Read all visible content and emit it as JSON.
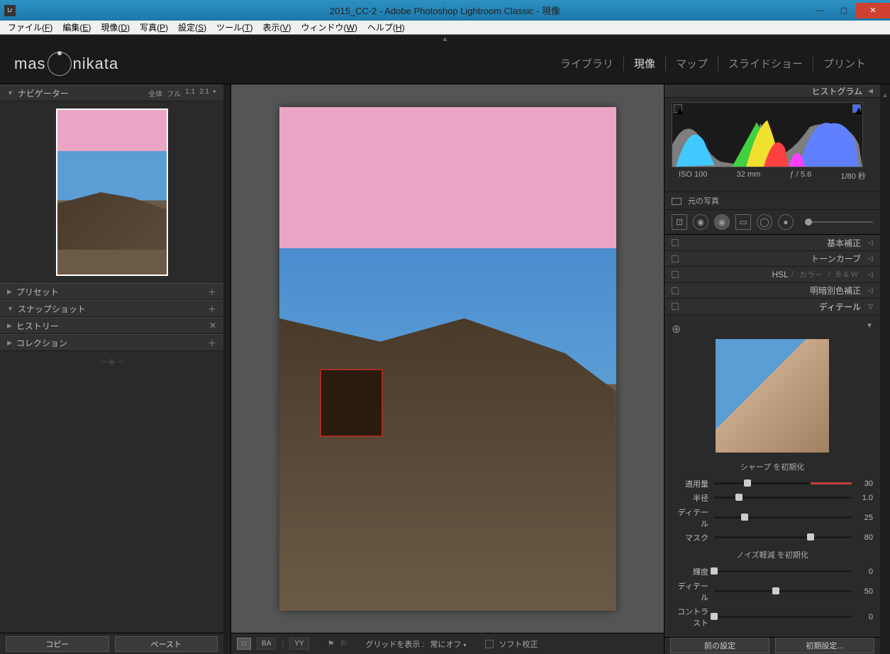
{
  "titlebar": {
    "icon_text": "Lr",
    "title": "2015_CC-2 - Adobe Photoshop Lightroom Classic - 現像"
  },
  "menubar": {
    "items": [
      {
        "label": "ファイル",
        "key": "F"
      },
      {
        "label": "編集",
        "key": "E"
      },
      {
        "label": "現像",
        "key": "D"
      },
      {
        "label": "写真",
        "key": "P"
      },
      {
        "label": "設定",
        "key": "S"
      },
      {
        "label": "ツール",
        "key": "T"
      },
      {
        "label": "表示",
        "key": "V"
      },
      {
        "label": "ウィンドウ",
        "key": "W"
      },
      {
        "label": "ヘルプ",
        "key": "H"
      }
    ]
  },
  "logo_text_pre": "mas",
  "logo_text_post": "nikata",
  "modules": [
    {
      "label": "ライブラリ",
      "active": false
    },
    {
      "label": "現像",
      "active": true
    },
    {
      "label": "マップ",
      "active": false
    },
    {
      "label": "スライドショー",
      "active": false
    },
    {
      "label": "プリント",
      "active": false
    }
  ],
  "left": {
    "navigator": {
      "title": "ナビゲーター",
      "zoom_opts": [
        "全体",
        "フル",
        "1:1",
        "2:1"
      ]
    },
    "presets": {
      "title": "プリセット"
    },
    "snapshots": {
      "title": "スナップショット"
    },
    "history": {
      "title": "ヒストリー"
    },
    "collections": {
      "title": "コレクション"
    },
    "copy_btn": "コピー",
    "paste_btn": "ペースト"
  },
  "center": {
    "grid_label": "グリッドを表示 :",
    "grid_value": "常にオフ",
    "soft_proof": "ソフト校正",
    "view_modes": [
      {
        "label": "□",
        "active": true
      },
      {
        "label": "BA",
        "active": false
      },
      {
        "label": "YY",
        "active": false
      }
    ]
  },
  "right": {
    "histogram_title": "ヒストグラム",
    "exif": {
      "iso": "ISO 100",
      "focal": "32 mm",
      "aperture": "ƒ / 5.6",
      "shutter": "1/80 秒"
    },
    "original": "元の写真",
    "panels": {
      "basic": "基本補正",
      "tone_curve": "トーンカーブ",
      "hsl": "HSL",
      "color": "カラー",
      "bw": "B & W",
      "split_tone": "明暗別色補正",
      "detail": "ディテール"
    },
    "detail": {
      "sharpen_title": "シャープ を初期化",
      "sliders": [
        {
          "label": "適用量",
          "value": "30",
          "pos": 24
        },
        {
          "label": "半径",
          "value": "1.0",
          "pos": 18
        },
        {
          "label": "ディテール",
          "value": "25",
          "pos": 22
        },
        {
          "label": "マスク",
          "value": "80",
          "pos": 70
        }
      ],
      "noise_title": "ノイズ軽減 を初期化",
      "noise_sliders": [
        {
          "label": "輝度",
          "value": "0",
          "pos": 0
        },
        {
          "label": "ディテール",
          "value": "50",
          "pos": 45
        },
        {
          "label": "コントラスト",
          "value": "0",
          "pos": 0
        }
      ]
    },
    "prev_btn": "前の設定",
    "reset_btn": "初期設定..."
  }
}
